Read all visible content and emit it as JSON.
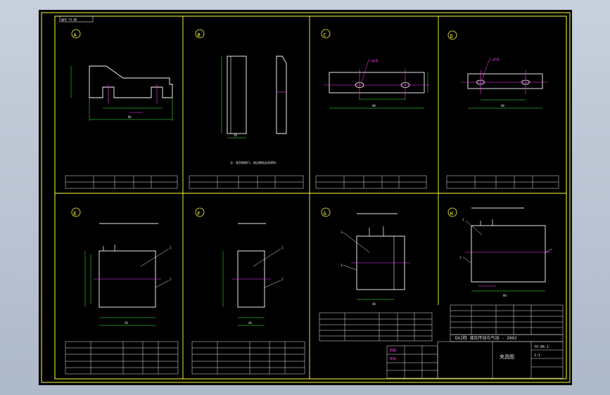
{
  "colors": {
    "background": "#000000",
    "frame": "#ffff3c",
    "outline": "#ffffff",
    "centerline": "#ff3cff",
    "dimension": "#3cff3c",
    "text": "#e8e8e8",
    "callout": "#ff3cff"
  },
  "drawing": {
    "corner_tag": "图号 YX-06",
    "view_labels": [
      "A",
      "B",
      "C",
      "D",
      "E",
      "F",
      "G",
      "H"
    ],
    "note_b": "注：其余倒角C1，锐边倒钝去毛刺Ra",
    "dim_a_total": "86",
    "dim_b_width": "18",
    "dim_c_hole": "2-φ6孔",
    "dim_c_total": "80",
    "dim_d_hole": "2-φ5孔",
    "dim_d_total": "80",
    "dim_e_bottom": "50",
    "dim_f_bottom": "40",
    "dim_g_bottom": "40",
    "dim_h_bottom": "80",
    "callout_1": "1",
    "callout_2": "2"
  },
  "title_block": {
    "school": "DXJ院 液压传动与气动 - 2002",
    "drawing_name": "夹具图",
    "drawn_by": "制图",
    "checked_by": "审核",
    "scale": "1:1",
    "sheet": "YX-06-1"
  }
}
